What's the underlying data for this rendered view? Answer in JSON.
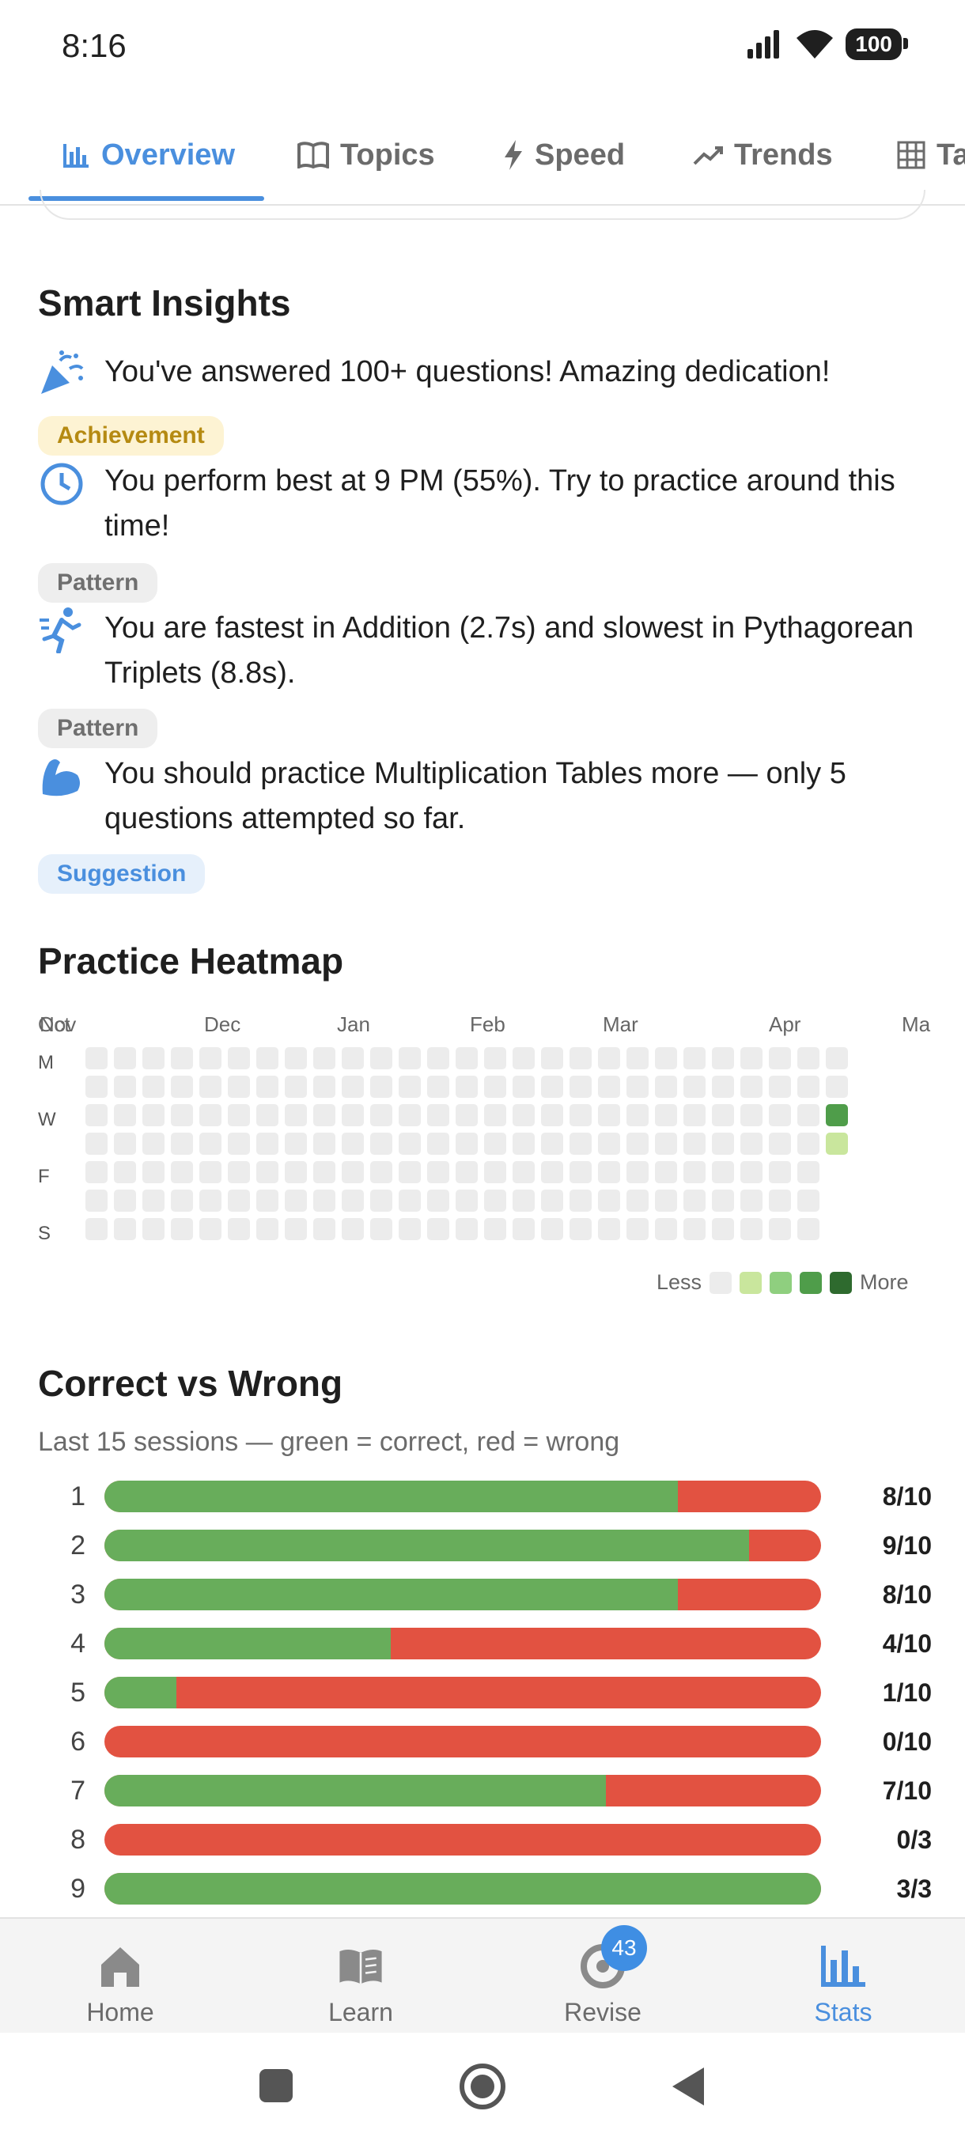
{
  "status": {
    "time": "8:16",
    "battery": "100"
  },
  "tabs": [
    {
      "label": "Overview",
      "icon": "bar-chart-icon"
    },
    {
      "label": "Topics",
      "icon": "book-icon"
    },
    {
      "label": "Speed",
      "icon": "bolt-icon"
    },
    {
      "label": "Trends",
      "icon": "trend-icon"
    },
    {
      "label": "Ta",
      "icon": "table-icon"
    }
  ],
  "insights": {
    "title": "Smart Insights",
    "items": [
      {
        "text": "You've answered 100+ questions! Amazing dedication!",
        "badge": "Achievement",
        "icon": "party-popper-icon"
      },
      {
        "text": "You perform best at 9 PM (55%). Try to practice around this time!",
        "badge": "Pattern",
        "icon": "clock-icon"
      },
      {
        "text": "You are fastest in Addition (2.7s) and slowest in Pythagorean Triplets (8.8s).",
        "badge": "Pattern",
        "icon": "runner-icon"
      },
      {
        "text": "You should practice Multiplication Tables more — only 5 questions attempted so far.",
        "badge": "Suggestion",
        "icon": "flexed-arm-icon"
      }
    ]
  },
  "heatmap": {
    "title": "Practice Heatmap",
    "months": [
      "Oct",
      "Nov",
      "Dec",
      "Jan",
      "Feb",
      "Mar",
      "Apr",
      "Ma"
    ],
    "days": [
      "M",
      "W",
      "F",
      "S"
    ],
    "legend_less": "Less",
    "legend_more": "More",
    "colors": [
      "#ececec",
      "#c9e69d",
      "#8fcf7f",
      "#4f9d4a",
      "#2e6a2e"
    ],
    "active_cells": [
      {
        "week": 26,
        "day": 2,
        "level": 3
      },
      {
        "week": 26,
        "day": 3,
        "level": 1
      }
    ]
  },
  "correct_wrong": {
    "title": "Correct vs Wrong",
    "subtitle": "Last 15 sessions — green = correct, red = wrong",
    "sessions": [
      {
        "n": "1",
        "correct": 8,
        "total": 10,
        "label": "8/10"
      },
      {
        "n": "2",
        "correct": 9,
        "total": 10,
        "label": "9/10"
      },
      {
        "n": "3",
        "correct": 8,
        "total": 10,
        "label": "8/10"
      },
      {
        "n": "4",
        "correct": 4,
        "total": 10,
        "label": "4/10"
      },
      {
        "n": "5",
        "correct": 1,
        "total": 10,
        "label": "1/10"
      },
      {
        "n": "6",
        "correct": 0,
        "total": 10,
        "label": "0/10"
      },
      {
        "n": "7",
        "correct": 7,
        "total": 10,
        "label": "7/10"
      },
      {
        "n": "8",
        "correct": 0,
        "total": 3,
        "label": "0/3"
      },
      {
        "n": "9",
        "correct": 3,
        "total": 3,
        "label": "3/3"
      }
    ]
  },
  "bottom_nav": {
    "items": [
      {
        "label": "Home",
        "icon": "home-icon"
      },
      {
        "label": "Learn",
        "icon": "book-open-icon"
      },
      {
        "label": "Revise",
        "icon": "target-icon"
      },
      {
        "label": "Stats",
        "icon": "stats-icon"
      }
    ],
    "revise_badge": "43",
    "active": "Stats"
  }
}
